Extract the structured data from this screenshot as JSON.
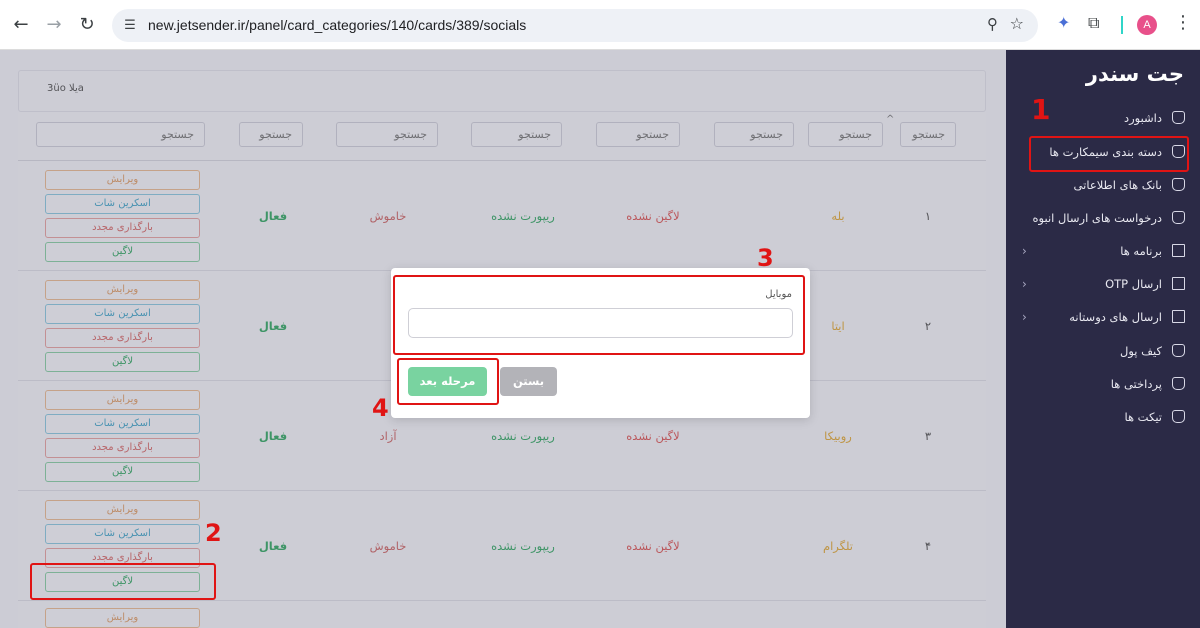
{
  "browser": {
    "url": "new.jetsender.ir/panel/card_categories/140/cards/389/socials",
    "avatar_letter": "A"
  },
  "sidebar": {
    "brand": "جت سندر",
    "items": [
      {
        "label": "داشبورد",
        "icon": "home-icon"
      },
      {
        "label": "دسته بندی سیمکارت ها",
        "icon": "home-icon"
      },
      {
        "label": "بانک های اطلاعاتی",
        "icon": "home-icon"
      },
      {
        "label": "درخواست های ارسال انبوه",
        "icon": "home-icon"
      },
      {
        "label": "برنامه ها",
        "icon": "book-icon"
      },
      {
        "label": "ارسال OTP",
        "icon": "book-icon"
      },
      {
        "label": "ارسال های دوستانه",
        "icon": "book-icon"
      },
      {
        "label": "کیف پول",
        "icon": "home-icon"
      },
      {
        "label": "پرداختی ها",
        "icon": "home-icon"
      },
      {
        "label": "تیکت ها",
        "icon": "home-icon"
      }
    ]
  },
  "header": {
    "crumb": "3üo يلاa"
  },
  "filters": {
    "placeholder": "جستجو"
  },
  "rows": [
    {
      "index": "۱",
      "platform": "بله",
      "login": "لاگین نشده",
      "report": "ریپورت نشده",
      "status": "خاموش",
      "active": "فعال"
    },
    {
      "index": "۲",
      "platform": "ایتا",
      "login": "",
      "report": "",
      "status": "وش",
      "active": "فعال"
    },
    {
      "index": "۳",
      "platform": "روبیکا",
      "login": "لاگین نشده",
      "report": "ریپورت نشده",
      "status": "آزاد",
      "active": "فعال"
    },
    {
      "index": "۴",
      "platform": "تلگرام",
      "login": "لاگین نشده",
      "report": "ریپورت نشده",
      "status": "خاموش",
      "active": "فعال"
    }
  ],
  "actions": {
    "edit": "ویرایش",
    "screenshot": "اسکرین شات",
    "reload": "بارگذاری مجدد",
    "login": "لاگین"
  },
  "modal": {
    "label": "موبایل",
    "input_value": "",
    "close": "بستن",
    "next": "مرحله بعد"
  },
  "annotations": {
    "n1": "1",
    "n2": "2",
    "n3": "3",
    "n4": "4"
  },
  "colors": {
    "annotation": "#e01414",
    "sidebar": "#2b2a46",
    "next_button": "#79d3a0"
  }
}
